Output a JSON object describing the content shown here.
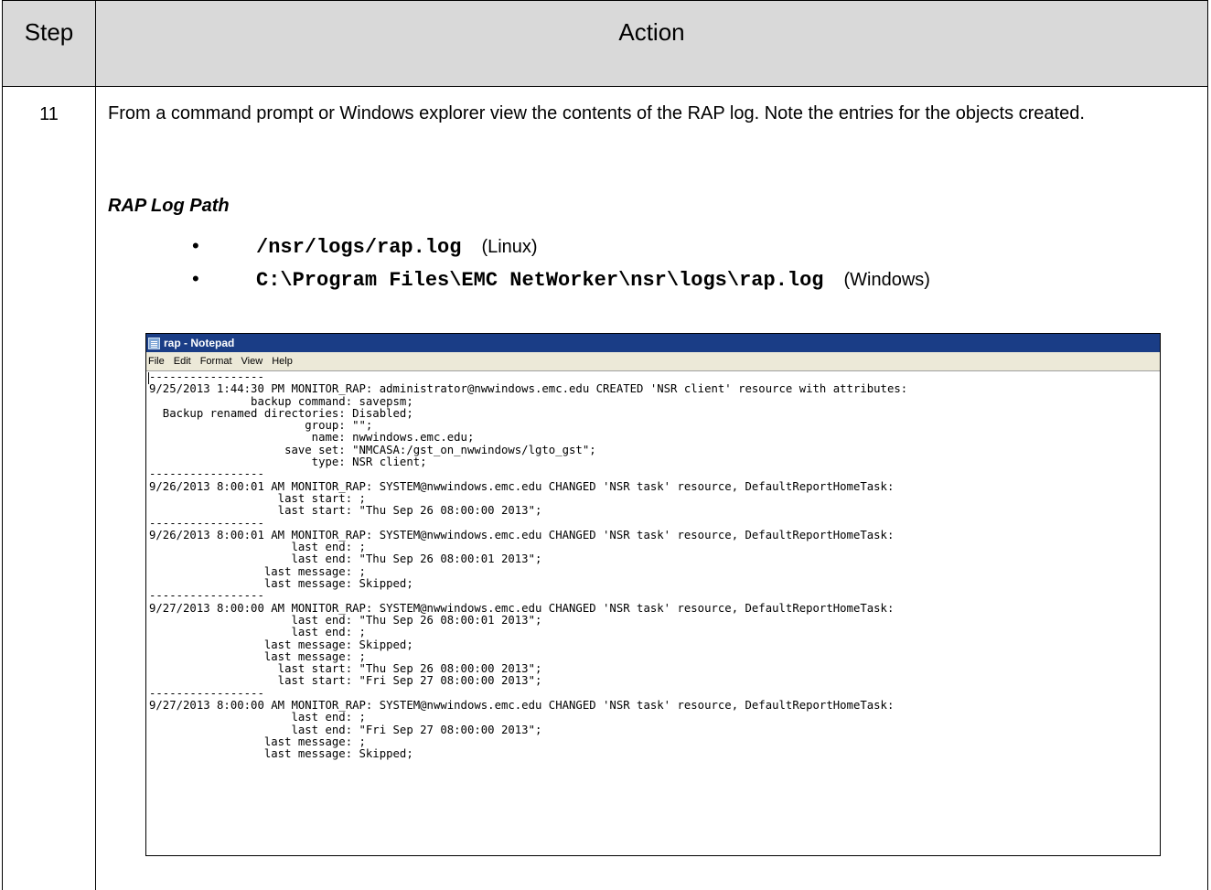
{
  "table": {
    "header_step": "Step",
    "header_action": "Action",
    "step_number": "11"
  },
  "content": {
    "intro": "From a command prompt or Windows explorer view the contents of the RAP log.  Note the entries for the objects created.",
    "rap_heading": "RAP Log Path",
    "paths": [
      {
        "path": "/nsr/logs/rap.log",
        "os": "(Linux)"
      },
      {
        "path": "C:\\Program Files\\EMC NetWorker\\nsr\\logs\\rap.log",
        "os": "(Windows)"
      }
    ]
  },
  "notepad": {
    "title": "rap - Notepad",
    "menu": [
      "File",
      "Edit",
      "Format",
      "View",
      "Help"
    ],
    "lines": [
      "-----------------",
      "9/25/2013 1:44:30 PM MONITOR_RAP: administrator@nwwindows.emc.edu CREATED 'NSR client' resource with attributes:",
      "               backup command: savepsm;",
      "  Backup renamed directories: Disabled;",
      "                       group: \"\";",
      "                        name: nwwindows.emc.edu;",
      "                    save set: \"NMCASA:/gst_on_nwwindows/lgto_gst\";",
      "                        type: NSR client;",
      "-----------------",
      "9/26/2013 8:00:01 AM MONITOR_RAP: SYSTEM@nwwindows.emc.edu CHANGED 'NSR task' resource, DefaultReportHomeTask:",
      "                   last start: ;",
      "                   last start: \"Thu Sep 26 08:00:00 2013\";",
      "-----------------",
      "9/26/2013 8:00:01 AM MONITOR_RAP: SYSTEM@nwwindows.emc.edu CHANGED 'NSR task' resource, DefaultReportHomeTask:",
      "                     last end: ;",
      "                     last end: \"Thu Sep 26 08:00:01 2013\";",
      "                 last message: ;",
      "                 last message: Skipped;",
      "-----------------",
      "9/27/2013 8:00:00 AM MONITOR_RAP: SYSTEM@nwwindows.emc.edu CHANGED 'NSR task' resource, DefaultReportHomeTask:",
      "                     last end: \"Thu Sep 26 08:00:01 2013\";",
      "                     last end: ;",
      "                 last message: Skipped;",
      "                 last message: ;",
      "                   last start: \"Thu Sep 26 08:00:00 2013\";",
      "                   last start: \"Fri Sep 27 08:00:00 2013\";",
      "-----------------",
      "9/27/2013 8:00:00 AM MONITOR_RAP: SYSTEM@nwwindows.emc.edu CHANGED 'NSR task' resource, DefaultReportHomeTask:",
      "                     last end: ;",
      "                     last end: \"Fri Sep 27 08:00:00 2013\";",
      "                 last message: ;",
      "                 last message: Skipped;"
    ]
  }
}
